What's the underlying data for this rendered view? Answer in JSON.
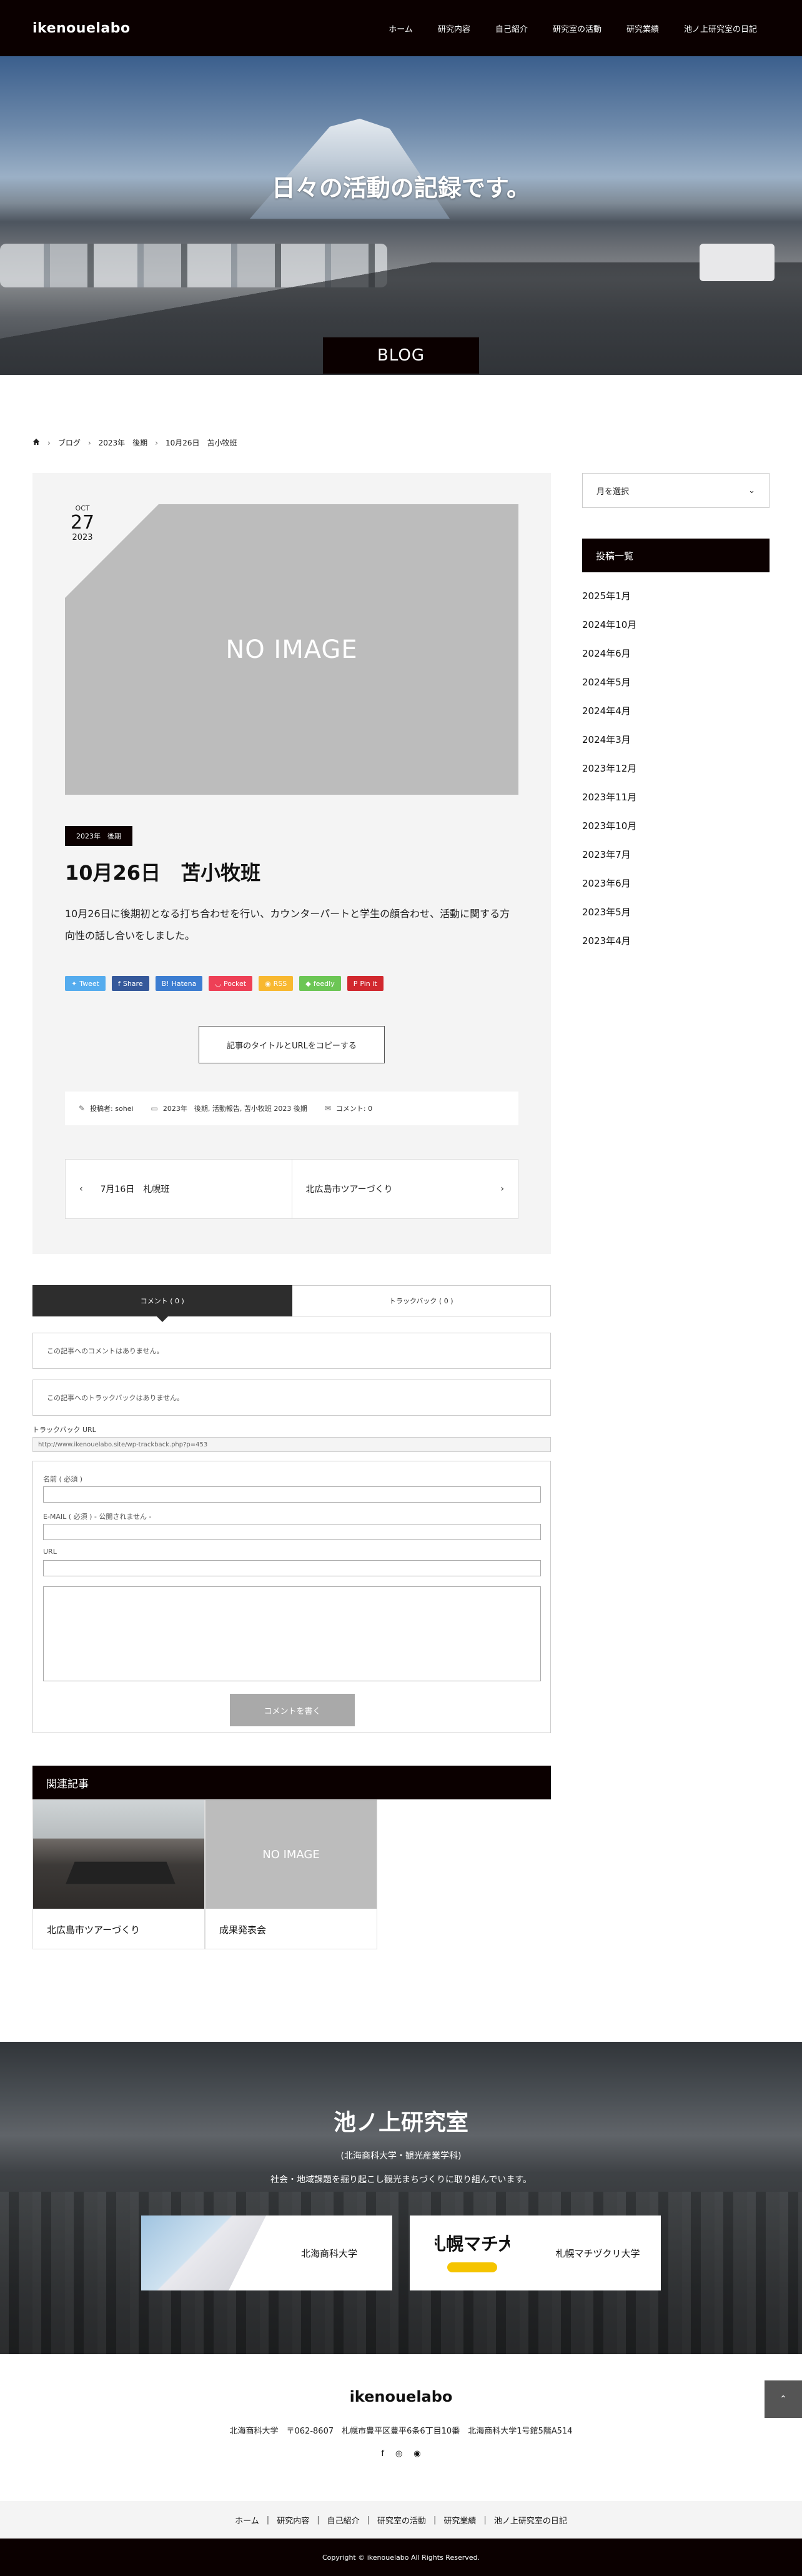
{
  "header": {
    "logo": "ikenouelabo",
    "nav": [
      "ホーム",
      "研究内容",
      "自己紹介",
      "研究室の活動",
      "研究業績",
      "池ノ上研究室の日記"
    ]
  },
  "hero": {
    "title": "日々の活動の記録です。",
    "badge": "BLOG"
  },
  "breadcrumb": [
    "ブログ",
    "2023年　後期",
    "10月26日　苫小牧班"
  ],
  "post": {
    "date_month": "OCT",
    "date_day": "27",
    "date_year": "2023",
    "thumb_text": "NO IMAGE",
    "category": "2023年　後期",
    "title": "10月26日　苫小牧班",
    "body": "10月26日に後期初となる打ち合わせを行い、カウンターパートと学生の顔合わせ、活動に関する方向性の話し合いをしました。",
    "share": [
      {
        "label": "Tweet",
        "color": "#55acee",
        "icon": "bird-icon"
      },
      {
        "label": "Share",
        "color": "#35589a",
        "icon": "f-icon"
      },
      {
        "label": "Hatena",
        "color": "#3c7dd1",
        "icon": "b-icon"
      },
      {
        "label": "Pocket",
        "color": "#ee4056",
        "icon": "pocket-icon"
      },
      {
        "label": "RSS",
        "color": "#f8b830",
        "icon": "rss-icon"
      },
      {
        "label": "feedly",
        "color": "#6cc655",
        "icon": "feedly-icon"
      },
      {
        "label": "Pin it",
        "color": "#d1282e",
        "icon": "pin-icon"
      }
    ],
    "copy_button": "記事のタイトルとURLをコピーする",
    "meta_author": "投稿者: sohei",
    "meta_categories": "2023年　後期, 活動報告, 苫小牧班 2023 後期",
    "meta_comments": "コメント: 0",
    "prev_post": "7月16日　札幌班",
    "next_post": "北広島市ツアーづくり"
  },
  "comments": {
    "tab_comments": "コメント ( 0 )",
    "tab_trackbacks": "トラックバック ( 0 )",
    "no_comments": "この記事へのコメントはありません。",
    "no_trackbacks": "この記事へのトラックバックはありません。",
    "trackback_label": "トラックバック URL",
    "trackback_url": "http://www.ikenouelabo.site/wp-trackback.php?p=453",
    "name_label": "名前 ( 必須 )",
    "email_label": "E-MAIL ( 必須 ) - 公開されません -",
    "url_label": "URL",
    "submit": "コメントを書く"
  },
  "related": {
    "title": "関連記事",
    "items": [
      {
        "caption": "北広島市ツアーづくり",
        "image": ""
      },
      {
        "caption": "成果発表会",
        "image": "NO IMAGE"
      }
    ]
  },
  "sidebar": {
    "select": "月を選択",
    "archive_title": "投稿一覧",
    "archives": [
      "2025年1月",
      "2024年10月",
      "2024年6月",
      "2024年5月",
      "2024年4月",
      "2024年3月",
      "2023年12月",
      "2023年11月",
      "2023年10月",
      "2023年7月",
      "2023年6月",
      "2023年5月",
      "2023年4月"
    ]
  },
  "footer_hero": {
    "title": "池ノ上研究室",
    "sub1": "(北海商科大学・観光産業学科)",
    "sub2": "社会・地域課題を掘り起こし観光まちづくりに取り組んでいます。",
    "cards": [
      {
        "name": "北海商科大学"
      },
      {
        "name": "札幌マチヅクリ大学",
        "logo_text": "札幌マチ大"
      }
    ]
  },
  "footer": {
    "logo": "ikenouelabo",
    "address": "北海商科大学　〒062-8607　札幌市豊平区豊平6条6丁目10番　北海商科大学1号館5階A514",
    "social": [
      "facebook-icon",
      "instagram-icon",
      "rss-icon"
    ],
    "nav": [
      "ホーム",
      "研究内容",
      "自己紹介",
      "研究室の活動",
      "研究業績",
      "池ノ上研究室の日記"
    ],
    "copyright": "Copyright © ikenouelabo All Rights Reserved."
  }
}
